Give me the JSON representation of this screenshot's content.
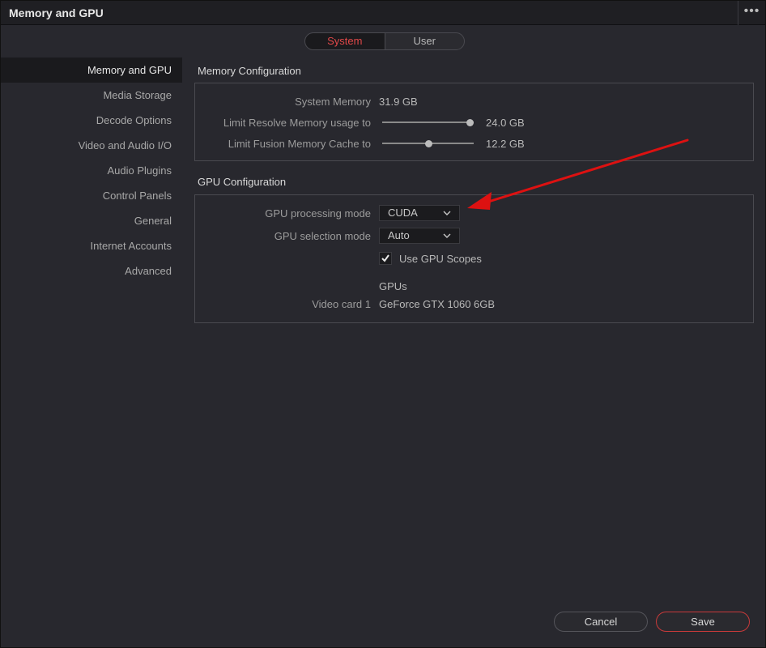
{
  "window": {
    "title": "Memory and GPU",
    "more_icon": "more-dots-icon"
  },
  "tabs": [
    {
      "label": "System",
      "active": true
    },
    {
      "label": "User",
      "active": false
    }
  ],
  "sidebar": {
    "items": [
      {
        "label": "Memory and GPU",
        "active": true
      },
      {
        "label": "Media Storage"
      },
      {
        "label": "Decode Options"
      },
      {
        "label": "Video and Audio I/O"
      },
      {
        "label": "Audio Plugins"
      },
      {
        "label": "Control Panels"
      },
      {
        "label": "General"
      },
      {
        "label": "Internet Accounts"
      },
      {
        "label": "Advanced"
      }
    ]
  },
  "memory": {
    "section_title": "Memory Configuration",
    "system_memory_label": "System Memory",
    "system_memory_value": "31.9 GB",
    "resolve_label": "Limit Resolve Memory usage to",
    "resolve_value": "24.0 GB",
    "resolve_fraction": 1.0,
    "fusion_label": "Limit Fusion Memory Cache to",
    "fusion_value": "12.2 GB",
    "fusion_fraction": 0.51
  },
  "gpu": {
    "section_title": "GPU Configuration",
    "processing_label": "GPU processing mode",
    "processing_value": "CUDA",
    "selection_label": "GPU selection mode",
    "selection_value": "Auto",
    "scopes_label": "Use GPU Scopes",
    "scopes_checked": true,
    "gpus_heading": "GPUs",
    "card_label": "Video card 1",
    "card_value": "GeForce GTX 1060 6GB"
  },
  "footer": {
    "cancel_label": "Cancel",
    "save_label": "Save"
  },
  "colors": {
    "accent": "#e04848",
    "annotation_arrow": "#dd1111"
  }
}
